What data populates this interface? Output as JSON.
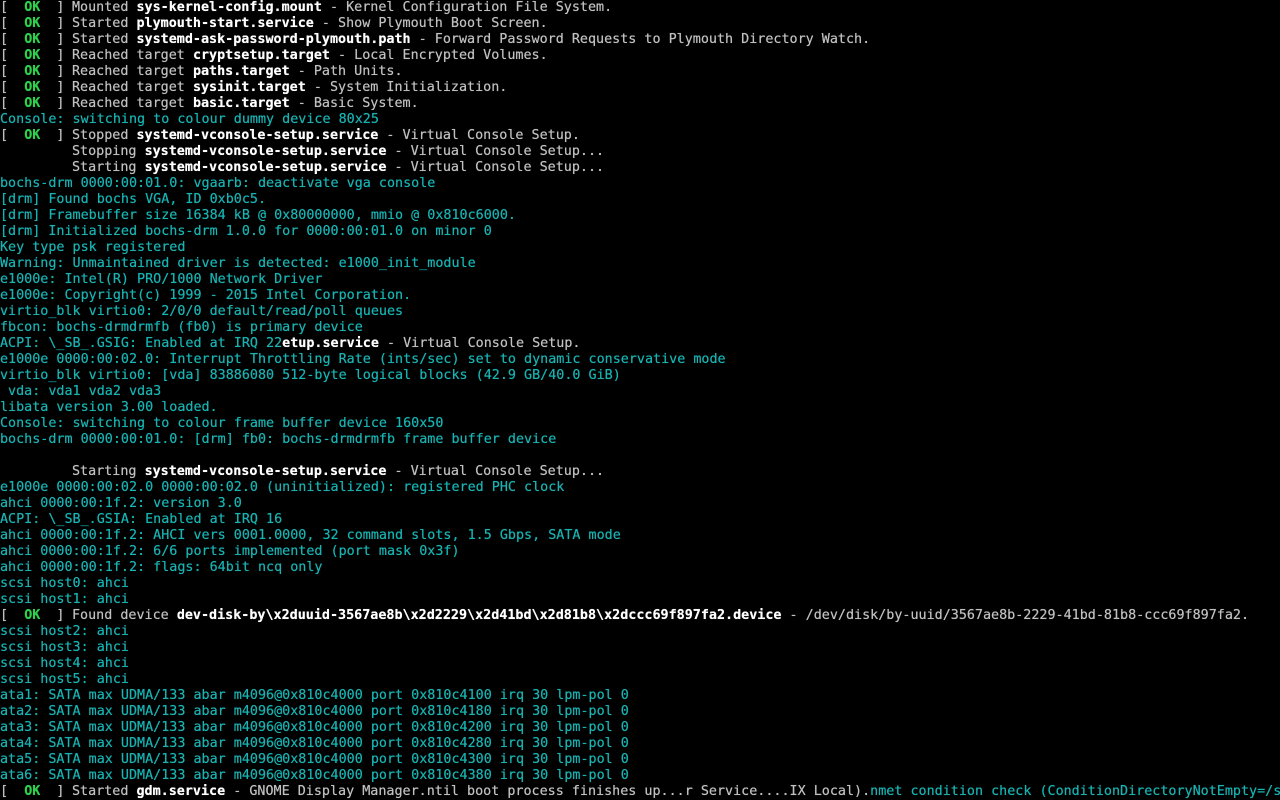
{
  "colors": {
    "background": "#000000",
    "ok": "#2ed14a",
    "kernel_message": "#18b2b2",
    "text": "#c0c0c0",
    "unit_highlight": "#ffffff"
  },
  "lines": [
    {
      "type": "systemd",
      "status": "OK",
      "verb": "Mounted",
      "unit": "sys-kernel-config.mount",
      "desc": " - Kernel Configuration File System."
    },
    {
      "type": "systemd",
      "status": "OK",
      "verb": "Started",
      "unit": "plymouth-start.service",
      "desc": " - Show Plymouth Boot Screen."
    },
    {
      "type": "systemd",
      "status": "OK",
      "verb": "Started",
      "unit": "systemd-ask-password-plymouth.path",
      "desc": " - Forward Password Requests to Plymouth Directory Watch."
    },
    {
      "type": "systemd",
      "status": "OK",
      "verb": "Reached target",
      "unit": "cryptsetup.target",
      "desc": " - Local Encrypted Volumes."
    },
    {
      "type": "systemd",
      "status": "OK",
      "verb": "Reached target",
      "unit": "paths.target",
      "desc": " - Path Units."
    },
    {
      "type": "systemd",
      "status": "OK",
      "verb": "Reached target",
      "unit": "sysinit.target",
      "desc": " - System Initialization."
    },
    {
      "type": "systemd",
      "status": "OK",
      "verb": "Reached target",
      "unit": "basic.target",
      "desc": " - Basic System."
    },
    {
      "type": "kmsg",
      "text": "Console: switching to colour dummy device 80x25"
    },
    {
      "type": "systemd",
      "status": "OK",
      "verb": "Stopped",
      "unit": "systemd-vconsole-setup.service",
      "desc": " - Virtual Console Setup."
    },
    {
      "type": "systemd",
      "status": "",
      "verb": "Stopping",
      "unit": "systemd-vconsole-setup.service",
      "desc": " - Virtual Console Setup..."
    },
    {
      "type": "systemd",
      "status": "",
      "verb": "Starting",
      "unit": "systemd-vconsole-setup.service",
      "desc": " - Virtual Console Setup..."
    },
    {
      "type": "kmsg",
      "text": "bochs-drm 0000:00:01.0: vgaarb: deactivate vga console"
    },
    {
      "type": "kmsg",
      "text": "[drm] Found bochs VGA, ID 0xb0c5."
    },
    {
      "type": "kmsg",
      "text": "[drm] Framebuffer size 16384 kB @ 0x80000000, mmio @ 0x810c6000."
    },
    {
      "type": "kmsg",
      "text": "[drm] Initialized bochs-drm 1.0.0 for 0000:00:01.0 on minor 0"
    },
    {
      "type": "kmsg",
      "text": "Key type psk registered"
    },
    {
      "type": "kmsg",
      "text": "Warning: Unmaintained driver is detected: e1000_init_module"
    },
    {
      "type": "kmsg",
      "text": "e1000e: Intel(R) PRO/1000 Network Driver"
    },
    {
      "type": "kmsg",
      "text": "e1000e: Copyright(c) 1999 - 2015 Intel Corporation."
    },
    {
      "type": "kmsg",
      "text": "virtio_blk virtio0: 2/0/0 default/read/poll queues"
    },
    {
      "type": "kmsg",
      "text": "fbcon: bochs-drmdrmfb (fb0) is primary device"
    },
    {
      "type": "mixed",
      "pre": "ACPI: \\_SB_.GSIG: Enabled at IRQ 22",
      "mid": "etup.service",
      "post": " - Virtual Console Setup."
    },
    {
      "type": "kmsg",
      "text": "e1000e 0000:00:02.0: Interrupt Throttling Rate (ints/sec) set to dynamic conservative mode"
    },
    {
      "type": "kmsg",
      "text": "virtio_blk virtio0: [vda] 83886080 512-byte logical blocks (42.9 GB/40.0 GiB)"
    },
    {
      "type": "kmsg",
      "text": " vda: vda1 vda2 vda3"
    },
    {
      "type": "kmsg",
      "text": "libata version 3.00 loaded."
    },
    {
      "type": "kmsg",
      "text": "Console: switching to colour frame buffer device 160x50"
    },
    {
      "type": "kmsg",
      "text": "bochs-drm 0000:00:01.0: [drm] fb0: bochs-drmdrmfb frame buffer device"
    },
    {
      "type": "blank",
      "text": ""
    },
    {
      "type": "systemd",
      "status": "",
      "verb": "Starting",
      "unit": "systemd-vconsole-setup.service",
      "desc": " - Virtual Console Setup..."
    },
    {
      "type": "kmsg",
      "text": "e1000e 0000:00:02.0 0000:00:02.0 (uninitialized): registered PHC clock"
    },
    {
      "type": "kmsg",
      "text": "ahci 0000:00:1f.2: version 3.0"
    },
    {
      "type": "kmsg",
      "text": "ACPI: \\_SB_.GSIA: Enabled at IRQ 16"
    },
    {
      "type": "kmsg",
      "text": "ahci 0000:00:1f.2: AHCI vers 0001.0000, 32 command slots, 1.5 Gbps, SATA mode"
    },
    {
      "type": "kmsg",
      "text": "ahci 0000:00:1f.2: 6/6 ports implemented (port mask 0x3f)"
    },
    {
      "type": "kmsg",
      "text": "ahci 0000:00:1f.2: flags: 64bit ncq only"
    },
    {
      "type": "kmsg",
      "text": "scsi host0: ahci"
    },
    {
      "type": "kmsg",
      "text": "scsi host1: ahci"
    },
    {
      "type": "systemd",
      "status": "OK",
      "verb": "Found device",
      "unit": "dev-disk-by\\x2duuid-3567ae8b\\x2d2229\\x2d41bd\\x2d81b8\\x2dccc69f897fa2.device",
      "desc": " - /dev/disk/by-uuid/3567ae8b-2229-41bd-81b8-ccc69f897fa2."
    },
    {
      "type": "kmsg",
      "text": "scsi host2: ahci"
    },
    {
      "type": "kmsg",
      "text": "scsi host3: ahci"
    },
    {
      "type": "kmsg",
      "text": "scsi host4: ahci"
    },
    {
      "type": "kmsg",
      "text": "scsi host5: ahci"
    },
    {
      "type": "kmsg",
      "text": "ata1: SATA max UDMA/133 abar m4096@0x810c4000 port 0x810c4100 irq 30 lpm-pol 0"
    },
    {
      "type": "kmsg",
      "text": "ata2: SATA max UDMA/133 abar m4096@0x810c4000 port 0x810c4180 irq 30 lpm-pol 0"
    },
    {
      "type": "kmsg",
      "text": "ata3: SATA max UDMA/133 abar m4096@0x810c4000 port 0x810c4200 irq 30 lpm-pol 0"
    },
    {
      "type": "kmsg",
      "text": "ata4: SATA max UDMA/133 abar m4096@0x810c4000 port 0x810c4280 irq 30 lpm-pol 0"
    },
    {
      "type": "kmsg",
      "text": "ata5: SATA max UDMA/133 abar m4096@0x810c4000 port 0x810c4300 irq 30 lpm-pol 0"
    },
    {
      "type": "kmsg",
      "text": "ata6: SATA max UDMA/133 abar m4096@0x810c4000 port 0x810c4380 irq 30 lpm-pol 0"
    },
    {
      "type": "last",
      "status": "OK",
      "verb": "Started",
      "unit": "gdm.service",
      "desc": " - GNOME Display Manager.ntil boot process finishes up...r Service....IX Local).",
      "tail": "nmet condition check (ConditionDirectoryNotEmpty=/sy"
    }
  ]
}
